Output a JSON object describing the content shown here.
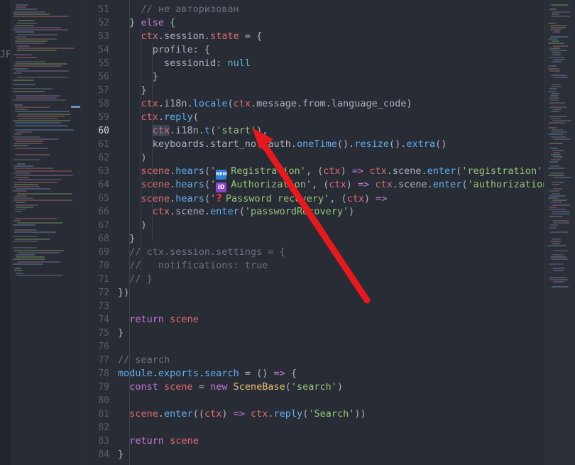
{
  "sidebar": {
    "label": "JF"
  },
  "colors": {
    "background": "#282c34",
    "arrow": "#e8181c"
  },
  "editor": {
    "active_line": "60",
    "lines": [
      {
        "n": "51",
        "tokens": [
          {
            "t": "    ",
            "c": "plain"
          },
          {
            "t": "// не авторизован",
            "c": "cm"
          }
        ]
      },
      {
        "n": "52",
        "tokens": [
          {
            "t": "  } ",
            "c": "plain"
          },
          {
            "t": "else",
            "c": "kw"
          },
          {
            "t": " {",
            "c": "plain"
          }
        ]
      },
      {
        "n": "53",
        "tokens": [
          {
            "t": "    ",
            "c": "plain"
          },
          {
            "t": "ctx",
            "c": "var"
          },
          {
            "t": ".session.",
            "c": "plain"
          },
          {
            "t": "state",
            "c": "var"
          },
          {
            "t": " = {",
            "c": "plain"
          }
        ]
      },
      {
        "n": "54",
        "tokens": [
          {
            "t": "      profile: {",
            "c": "plain"
          }
        ]
      },
      {
        "n": "55",
        "tokens": [
          {
            "t": "        sessionid: ",
            "c": "plain"
          },
          {
            "t": "null",
            "c": "null"
          }
        ]
      },
      {
        "n": "56",
        "tokens": [
          {
            "t": "      }",
            "c": "plain"
          }
        ]
      },
      {
        "n": "57",
        "tokens": [
          {
            "t": "    }",
            "c": "plain"
          }
        ]
      },
      {
        "n": "58",
        "tokens": [
          {
            "t": "    ",
            "c": "plain"
          },
          {
            "t": "ctx",
            "c": "var"
          },
          {
            "t": ".i18n.",
            "c": "plain"
          },
          {
            "t": "locale",
            "c": "fn"
          },
          {
            "t": "(",
            "c": "plain"
          },
          {
            "t": "ctx",
            "c": "var"
          },
          {
            "t": ".message.from.language_code)",
            "c": "plain"
          }
        ]
      },
      {
        "n": "59",
        "tokens": [
          {
            "t": "    ",
            "c": "plain"
          },
          {
            "t": "ctx",
            "c": "var"
          },
          {
            "t": ".",
            "c": "plain"
          },
          {
            "t": "reply",
            "c": "fn"
          },
          {
            "t": "(",
            "c": "plain"
          }
        ]
      },
      {
        "n": "60",
        "tokens": [
          {
            "t": "      ",
            "c": "plain"
          },
          {
            "t": "ctx",
            "c": "var"
          },
          {
            "t": ".i18n.",
            "c": "plain"
          },
          {
            "t": "t",
            "c": "fn"
          },
          {
            "t": "(",
            "c": "plain"
          },
          {
            "t": "'start'",
            "c": "str"
          },
          {
            "t": "),",
            "c": "plain"
          }
        ]
      },
      {
        "n": "61",
        "tokens": [
          {
            "t": "      keyboards.start_not_auth.",
            "c": "plain"
          },
          {
            "t": "oneTime",
            "c": "fn"
          },
          {
            "t": "().",
            "c": "plain"
          },
          {
            "t": "resize",
            "c": "fn"
          },
          {
            "t": "().",
            "c": "plain"
          },
          {
            "t": "extra",
            "c": "fn"
          },
          {
            "t": "()",
            "c": "plain"
          }
        ]
      },
      {
        "n": "62",
        "tokens": [
          {
            "t": "    )",
            "c": "plain"
          }
        ]
      },
      {
        "n": "63",
        "tokens": [
          {
            "t": "    ",
            "c": "plain"
          },
          {
            "t": "scene",
            "c": "var"
          },
          {
            "t": ".",
            "c": "plain"
          },
          {
            "t": "hears",
            "c": "fn"
          },
          {
            "t": "('",
            "c": "plain"
          },
          {
            "t": "NEW",
            "c": "emoji-new"
          },
          {
            "t": "Registration'",
            "c": "str"
          },
          {
            "t": ", (",
            "c": "plain"
          },
          {
            "t": "ctx",
            "c": "var"
          },
          {
            "t": ") ",
            "c": "plain"
          },
          {
            "t": "=>",
            "c": "kw"
          },
          {
            "t": " ",
            "c": "plain"
          },
          {
            "t": "ctx",
            "c": "var"
          },
          {
            "t": ".scene.",
            "c": "plain"
          },
          {
            "t": "enter",
            "c": "fn"
          },
          {
            "t": "(",
            "c": "plain"
          },
          {
            "t": "'registration'",
            "c": "str"
          },
          {
            "t": ")",
            "c": "plain"
          }
        ]
      },
      {
        "n": "64",
        "tokens": [
          {
            "t": "    ",
            "c": "plain"
          },
          {
            "t": "scene",
            "c": "var"
          },
          {
            "t": ".",
            "c": "plain"
          },
          {
            "t": "hears",
            "c": "fn"
          },
          {
            "t": "('",
            "c": "plain"
          },
          {
            "t": "ID",
            "c": "emoji-id"
          },
          {
            "t": "Authorization'",
            "c": "str"
          },
          {
            "t": ", (",
            "c": "plain"
          },
          {
            "t": "ctx",
            "c": "var"
          },
          {
            "t": ") ",
            "c": "plain"
          },
          {
            "t": "=>",
            "c": "kw"
          },
          {
            "t": " ",
            "c": "plain"
          },
          {
            "t": "ctx",
            "c": "var"
          },
          {
            "t": ".scene.",
            "c": "plain"
          },
          {
            "t": "enter",
            "c": "fn"
          },
          {
            "t": "(",
            "c": "plain"
          },
          {
            "t": "'authorization",
            "c": "str"
          }
        ]
      },
      {
        "n": "65",
        "tokens": [
          {
            "t": "    ",
            "c": "plain"
          },
          {
            "t": "scene",
            "c": "var"
          },
          {
            "t": ".",
            "c": "plain"
          },
          {
            "t": "hears",
            "c": "fn"
          },
          {
            "t": "('",
            "c": "plain"
          },
          {
            "t": "?",
            "c": "emoji-q"
          },
          {
            "t": "Password recovery'",
            "c": "str"
          },
          {
            "t": ", (",
            "c": "plain"
          },
          {
            "t": "ctx",
            "c": "var"
          },
          {
            "t": ") ",
            "c": "plain"
          },
          {
            "t": "=>",
            "c": "kw"
          }
        ]
      },
      {
        "n": "66",
        "tokens": [
          {
            "t": "      ",
            "c": "plain"
          },
          {
            "t": "ctx",
            "c": "var"
          },
          {
            "t": ".scene.",
            "c": "plain"
          },
          {
            "t": "enter",
            "c": "fn"
          },
          {
            "t": "(",
            "c": "plain"
          },
          {
            "t": "'passwordRecovery'",
            "c": "str"
          },
          {
            "t": ")",
            "c": "plain"
          }
        ]
      },
      {
        "n": "67",
        "tokens": [
          {
            "t": "    )",
            "c": "plain"
          }
        ]
      },
      {
        "n": "68",
        "tokens": [
          {
            "t": "  }",
            "c": "plain"
          }
        ]
      },
      {
        "n": "69",
        "tokens": [
          {
            "t": "  ",
            "c": "plain"
          },
          {
            "t": "// ctx.session.settings = {",
            "c": "cm"
          }
        ]
      },
      {
        "n": "70",
        "tokens": [
          {
            "t": "  ",
            "c": "plain"
          },
          {
            "t": "//   notifications: true",
            "c": "cm"
          }
        ]
      },
      {
        "n": "71",
        "tokens": [
          {
            "t": "  ",
            "c": "plain"
          },
          {
            "t": "// }",
            "c": "cm"
          }
        ]
      },
      {
        "n": "72",
        "tokens": [
          {
            "t": "})",
            "c": "plain"
          }
        ]
      },
      {
        "n": "73",
        "tokens": []
      },
      {
        "n": "74",
        "tokens": [
          {
            "t": "  ",
            "c": "plain"
          },
          {
            "t": "return",
            "c": "kw"
          },
          {
            "t": " ",
            "c": "plain"
          },
          {
            "t": "scene",
            "c": "var"
          }
        ]
      },
      {
        "n": "75",
        "tokens": [
          {
            "t": "}",
            "c": "plain"
          }
        ]
      },
      {
        "n": "76",
        "tokens": []
      },
      {
        "n": "77",
        "tokens": [
          {
            "t": "// search",
            "c": "cm"
          }
        ]
      },
      {
        "n": "78",
        "tokens": [
          {
            "t": "module",
            "c": "fn"
          },
          {
            "t": ".",
            "c": "plain"
          },
          {
            "t": "exports",
            "c": "fn"
          },
          {
            "t": ".",
            "c": "plain"
          },
          {
            "t": "search",
            "c": "fn"
          },
          {
            "t": " = () ",
            "c": "plain"
          },
          {
            "t": "=>",
            "c": "kw"
          },
          {
            "t": " {",
            "c": "plain"
          }
        ]
      },
      {
        "n": "79",
        "tokens": [
          {
            "t": "  ",
            "c": "plain"
          },
          {
            "t": "const",
            "c": "kw"
          },
          {
            "t": " ",
            "c": "plain"
          },
          {
            "t": "scene",
            "c": "var"
          },
          {
            "t": " = ",
            "c": "plain"
          },
          {
            "t": "new",
            "c": "kw"
          },
          {
            "t": " ",
            "c": "plain"
          },
          {
            "t": "SceneBase",
            "c": "prop"
          },
          {
            "t": "(",
            "c": "plain"
          },
          {
            "t": "'search'",
            "c": "str"
          },
          {
            "t": ")",
            "c": "plain"
          }
        ]
      },
      {
        "n": "80",
        "tokens": []
      },
      {
        "n": "81",
        "tokens": [
          {
            "t": "  ",
            "c": "plain"
          },
          {
            "t": "scene",
            "c": "var"
          },
          {
            "t": ".",
            "c": "plain"
          },
          {
            "t": "enter",
            "c": "fn"
          },
          {
            "t": "((",
            "c": "plain"
          },
          {
            "t": "ctx",
            "c": "var"
          },
          {
            "t": ") ",
            "c": "plain"
          },
          {
            "t": "=>",
            "c": "kw"
          },
          {
            "t": " ",
            "c": "plain"
          },
          {
            "t": "ctx",
            "c": "var"
          },
          {
            "t": ".",
            "c": "plain"
          },
          {
            "t": "reply",
            "c": "fn"
          },
          {
            "t": "(",
            "c": "plain"
          },
          {
            "t": "'Search'",
            "c": "str"
          },
          {
            "t": "))",
            "c": "plain"
          }
        ]
      },
      {
        "n": "82",
        "tokens": []
      },
      {
        "n": "83",
        "tokens": [
          {
            "t": "  ",
            "c": "plain"
          },
          {
            "t": "return",
            "c": "kw"
          },
          {
            "t": " ",
            "c": "plain"
          },
          {
            "t": "scene",
            "c": "var"
          }
        ]
      },
      {
        "n": "84",
        "tokens": [
          {
            "t": "}",
            "c": "plain"
          }
        ]
      }
    ]
  }
}
